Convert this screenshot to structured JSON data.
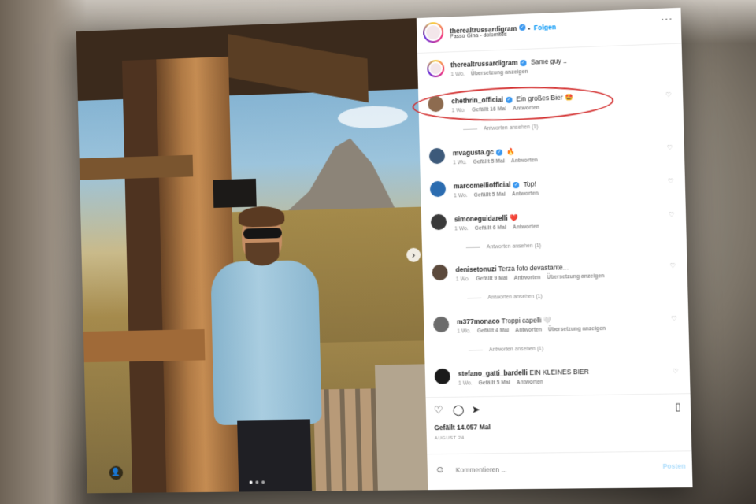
{
  "post": {
    "author": "therealtrussardigram",
    "follow_label": "Folgen",
    "location": "Passo Gina - dolomites",
    "more_label": "···"
  },
  "comments": [
    {
      "user": "therealtrussardigram",
      "verified": true,
      "text": "Same guy ..",
      "time": "1 Wo.",
      "likes": "",
      "reply": "",
      "translate": "Übersetzung anzeigen",
      "view_replies": ""
    },
    {
      "user": "chethrin_official",
      "verified": true,
      "text": "Ein großes Bier 🤩",
      "time": "1 Wo.",
      "likes": "Gefällt 16 Mal",
      "reply": "Antworten",
      "translate": "",
      "view_replies": "Antworten ansehen (1)",
      "highlighted": true
    },
    {
      "user": "mvagusta.gc",
      "verified": true,
      "text": "🔥",
      "time": "1 Wo.",
      "likes": "Gefällt 5 Mal",
      "reply": "Antworten",
      "translate": "",
      "view_replies": ""
    },
    {
      "user": "marcomelliofficial",
      "verified": true,
      "text": "Top!",
      "time": "1 Wo.",
      "likes": "Gefällt 5 Mal",
      "reply": "Antworten",
      "translate": "",
      "view_replies": ""
    },
    {
      "user": "simoneguidarelli",
      "verified": false,
      "text": "❤️",
      "time": "1 Wo.",
      "likes": "Gefällt 6 Mal",
      "reply": "Antworten",
      "translate": "",
      "view_replies": "Antworten ansehen (1)"
    },
    {
      "user": "denisetonuzi",
      "verified": false,
      "text": "Terza foto devastante...",
      "time": "1 Wo.",
      "likes": "Gefällt 9 Mal",
      "reply": "Antworten",
      "translate": "Übersetzung anzeigen",
      "view_replies": "Antworten ansehen (1)"
    },
    {
      "user": "m377monaco",
      "verified": false,
      "text": "Troppi capelli 🤍",
      "time": "1 Wo.",
      "likes": "Gefällt 4 Mal",
      "reply": "Antworten",
      "translate": "Übersetzung anzeigen",
      "view_replies": "Antworten ansehen (1)"
    },
    {
      "user": "stefano_gatti_bardelli",
      "verified": false,
      "text": "EIN KLEINES BIER",
      "time": "1 Wo.",
      "likes": "Gefällt 5 Mal",
      "reply": "Antworten",
      "translate": "",
      "view_replies": ""
    }
  ],
  "footer": {
    "likes": "Gefällt 14.057 Mal",
    "date": "AUGUST 24",
    "comment_placeholder": "Kommentieren ...",
    "post_label": "Posten"
  },
  "colors": {
    "accent": "#0095f6",
    "highlight_ring": "#d32f2f",
    "heart": "#ed4956"
  },
  "icons": [
    "heart-icon",
    "comment-icon",
    "share-icon",
    "bookmark-icon",
    "emoji-icon",
    "more-icon",
    "verified-icon",
    "chevron-right-icon",
    "user-tag-icon"
  ]
}
